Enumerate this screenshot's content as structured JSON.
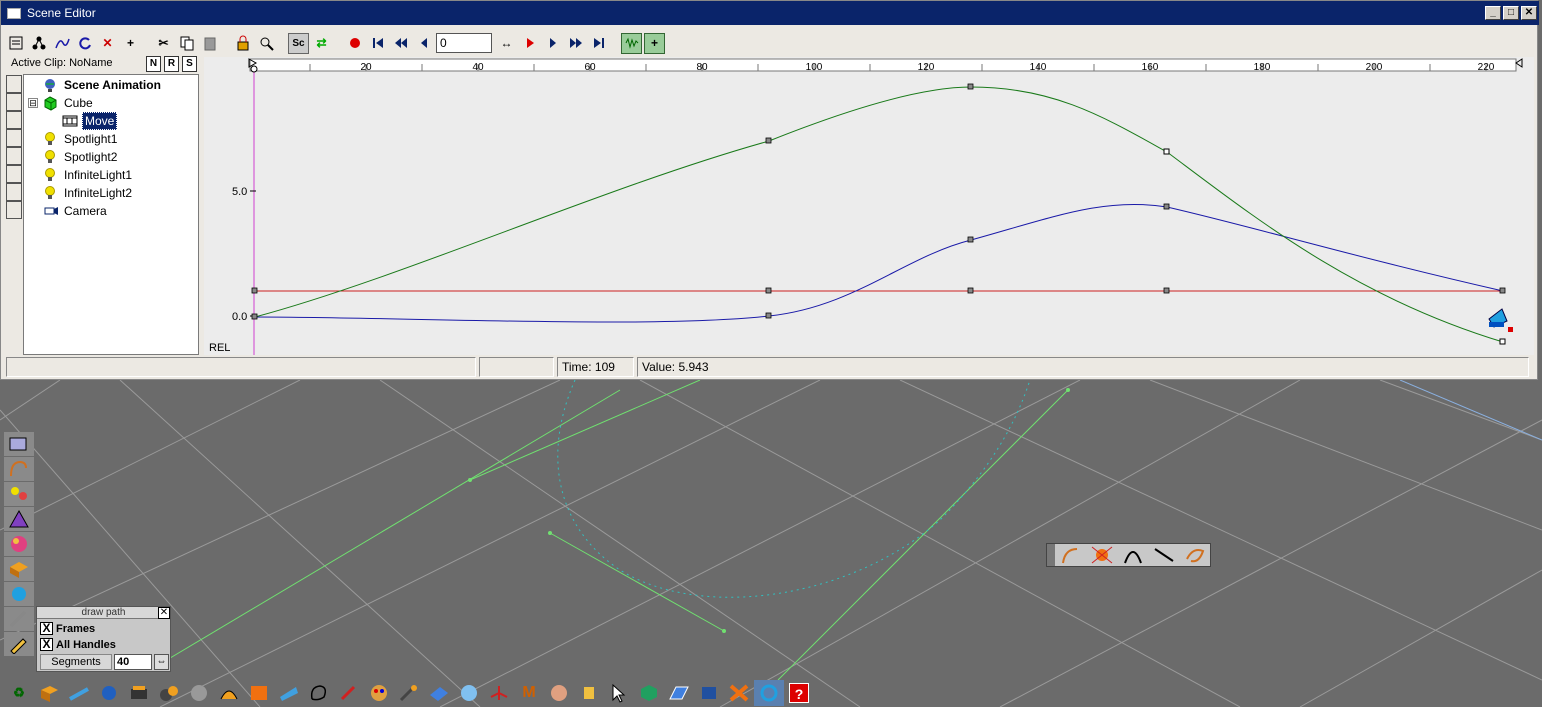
{
  "window": {
    "title": "Scene Editor"
  },
  "toolbar": {
    "frame_value": "0",
    "sc_label": "Sc"
  },
  "clip": {
    "label": "Active Clip: NoName",
    "buttons": [
      "N",
      "R",
      "S"
    ]
  },
  "tree": {
    "items": [
      {
        "label": "Scene Animation",
        "icon": "globe-icon",
        "bold": true
      },
      {
        "label": "Cube",
        "icon": "cube-icon",
        "expander": "⊟"
      },
      {
        "label": "Move",
        "icon": "film-icon",
        "selected": true
      },
      {
        "label": "Spotlight1",
        "icon": "bulb-icon"
      },
      {
        "label": "Spotlight2",
        "icon": "bulb-icon"
      },
      {
        "label": "InfiniteLight1",
        "icon": "bulb-icon"
      },
      {
        "label": "InfiniteLight2",
        "icon": "bulb-icon"
      },
      {
        "label": "Camera",
        "icon": "camera-icon"
      }
    ]
  },
  "graph": {
    "ruler_ticks": [
      "20",
      "40",
      "60",
      "80",
      "100",
      "120",
      "140",
      "160",
      "180",
      "200",
      "220"
    ],
    "y_labels": [
      "5.0",
      "0.0"
    ],
    "rel_label": "REL",
    "colors": {
      "green": "#1a7a1a",
      "blue": "#1a1aa8",
      "red": "#cc2020",
      "cursor": "#d040d0"
    }
  },
  "status": {
    "time": "Time: 109",
    "value": "Value: 5.943"
  },
  "draw_path": {
    "title": "draw path",
    "frames_label": "Frames",
    "frames_checked": "X",
    "handles_label": "All Handles",
    "handles_checked": "X",
    "segments_label": "Segments",
    "segments_value": "40"
  },
  "help_icon": "?"
}
